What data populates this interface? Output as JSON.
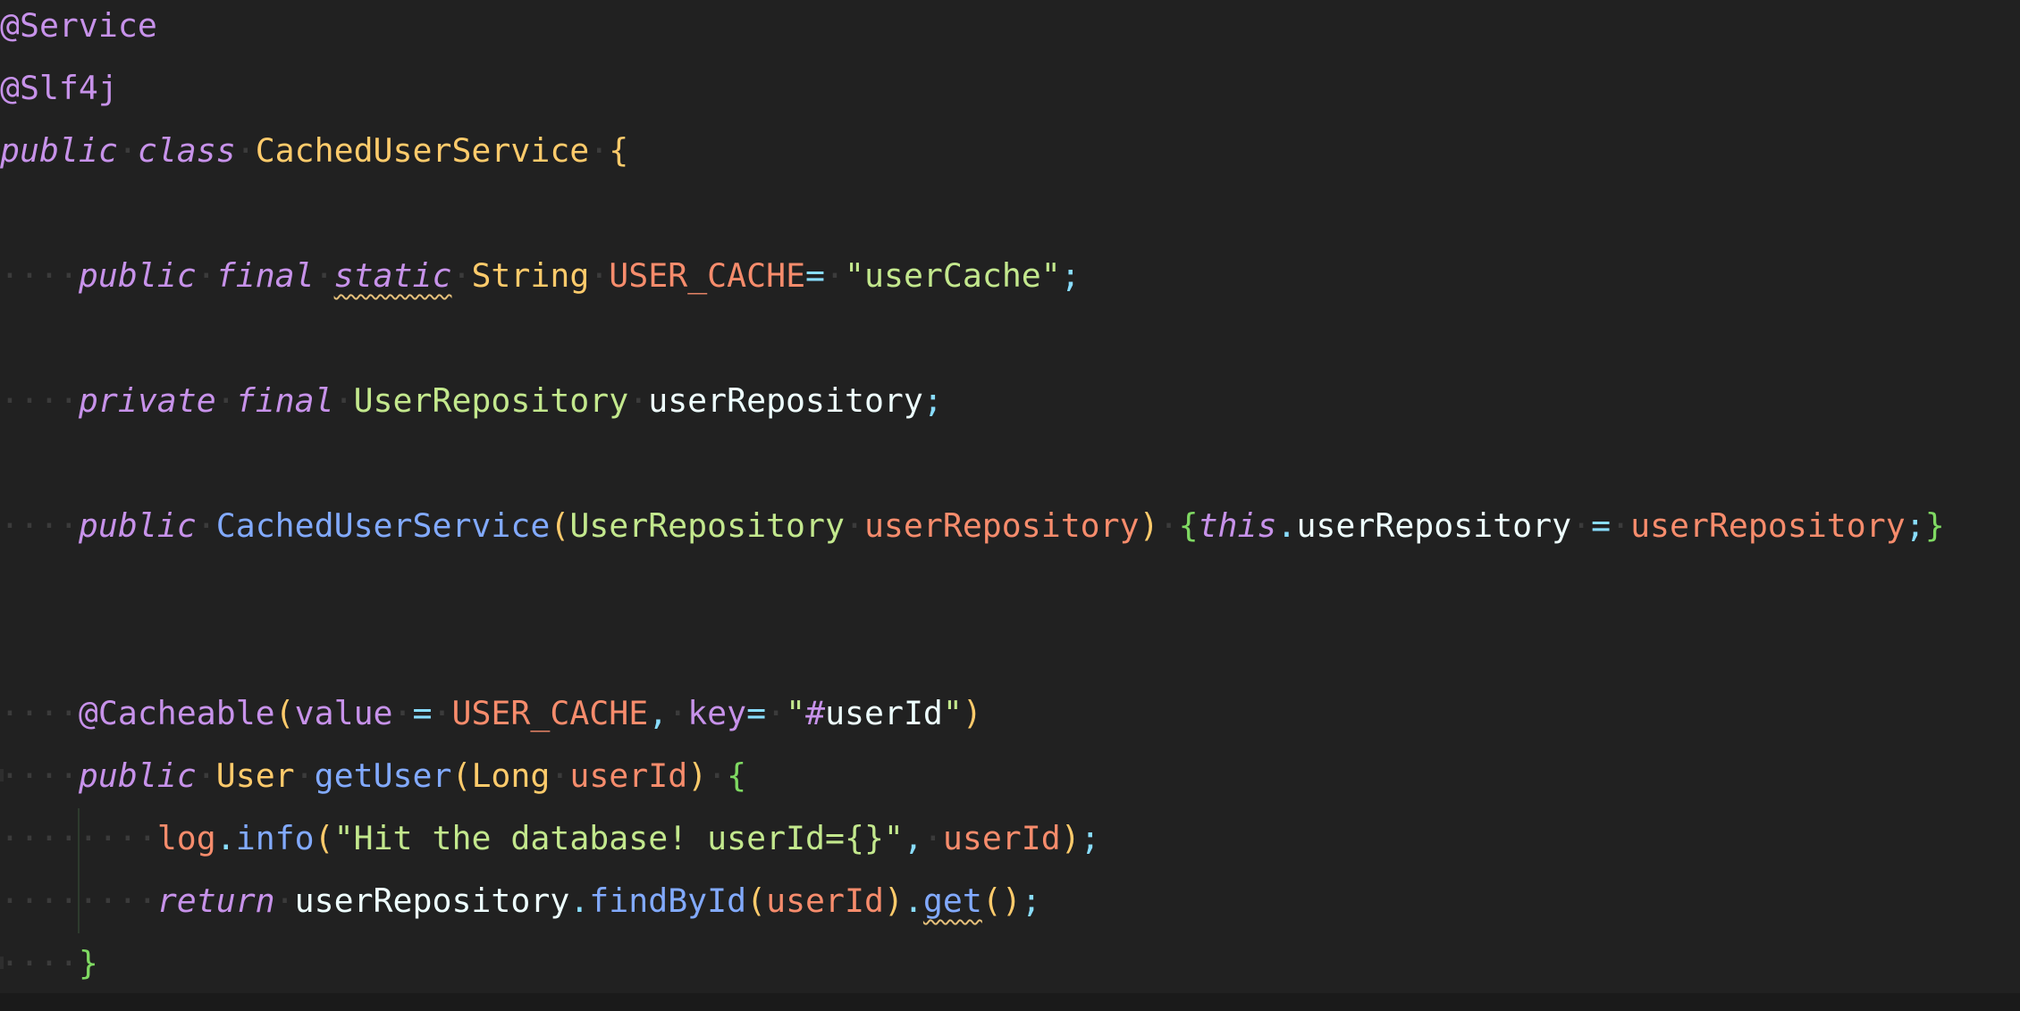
{
  "code": {
    "ann_service": "@Service",
    "ann_slf4j": "@Slf4j",
    "l3_public": "public",
    "l3_class": "class",
    "l3_name": "CachedUserService",
    "l3_brace": "{",
    "l5_public": "public",
    "l5_final": "final",
    "l5_static": "static",
    "l5_type": "String",
    "l5_const": "USER_CACHE",
    "l5_eq": "=",
    "l5_str": "\"userCache\"",
    "l5_semi": ";",
    "l7_private": "private",
    "l7_final": "final",
    "l7_type": "UserRepository",
    "l7_field": "userRepository",
    "l7_semi": ";",
    "l9_public": "public",
    "l9_ctor": "CachedUserService",
    "l9_lp": "(",
    "l9_ptype": "UserRepository",
    "l9_pname": "userRepository",
    "l9_rp": ")",
    "l9_lb": "{",
    "l9_this": "this",
    "l9_dot": ".",
    "l9_field": "userRepository",
    "l9_eq": "=",
    "l9_rhs": "userRepository",
    "l9_semi": ";",
    "l9_rb": "}",
    "l12_ann": "@Cacheable",
    "l12_lp": "(",
    "l12_value": "value",
    "l12_eq1": "=",
    "l12_const": "USER_CACHE",
    "l12_comma": ",",
    "l12_key": "key",
    "l12_eq2": "=",
    "l12_q1": "\"",
    "l12_hash": "#",
    "l12_var": "userId",
    "l12_q2": "\"",
    "l12_rp": ")",
    "l13_public": "public",
    "l13_type": "User",
    "l13_fn": "getUser",
    "l13_lp": "(",
    "l13_ptype": "Long",
    "l13_pname": "userId",
    "l13_rp": ")",
    "l13_lb": "{",
    "l14_log": "log",
    "l14_dot": ".",
    "l14_fn": "info",
    "l14_lp": "(",
    "l14_str": "\"Hit the database! userId={}\"",
    "l14_comma": ",",
    "l14_arg": "userId",
    "l14_rp": ")",
    "l14_semi": ";",
    "l15_return": "return",
    "l15_obj": "userRepository",
    "l15_dot1": ".",
    "l15_fn": "findById",
    "l15_lp": "(",
    "l15_arg": "userId",
    "l15_rp": ")",
    "l15_dot2": ".",
    "l15_get": "get",
    "l15_call": "()",
    "l15_semi": ";",
    "l16_rb": "}"
  }
}
